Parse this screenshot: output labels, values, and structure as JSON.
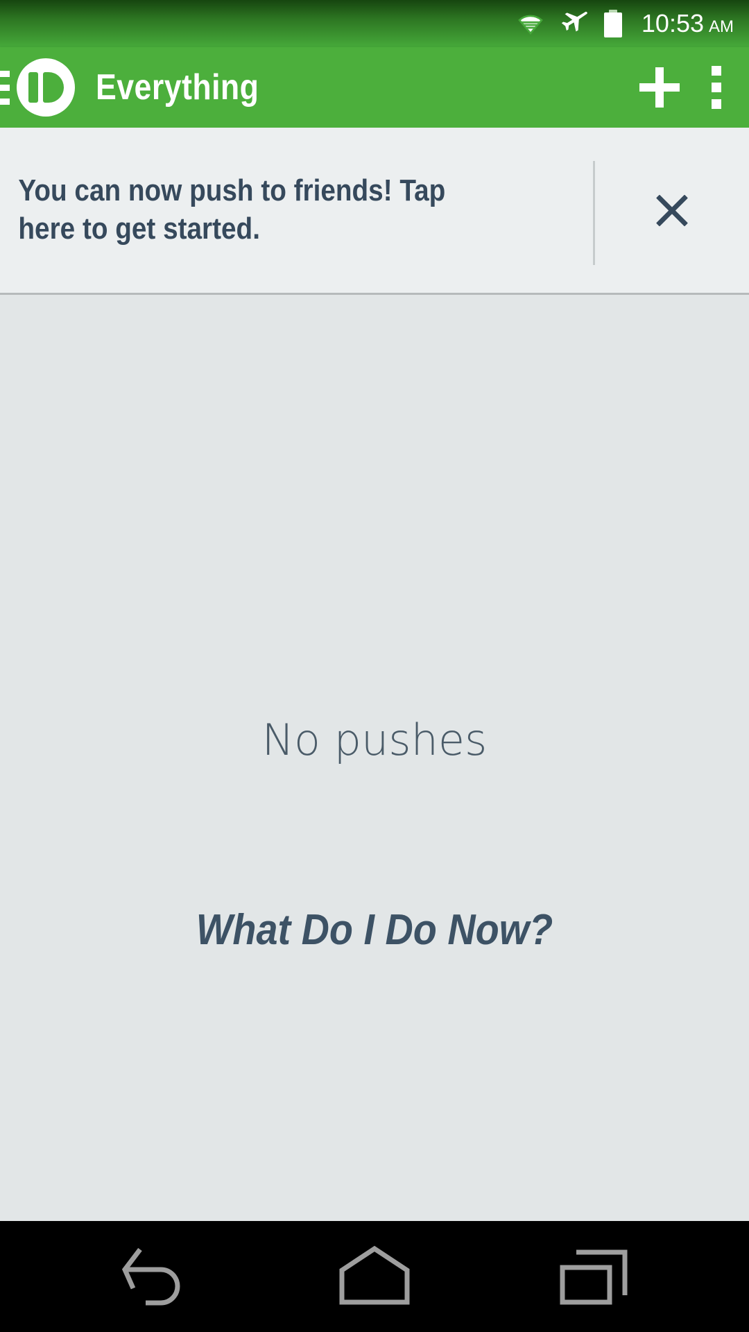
{
  "status_bar": {
    "wifi_icon": "wifi-icon",
    "airplane_icon": "airplane-mode-icon",
    "battery_icon": "battery-icon",
    "time": "10:53",
    "meridiem": "AM"
  },
  "action_bar": {
    "menu_icon": "hamburger-menu-icon",
    "logo_icon": "pushbullet-logo-icon",
    "title": "Everything",
    "add_icon": "plus-icon",
    "overflow_icon": "overflow-menu-icon",
    "background_color": "#4caf3c"
  },
  "banner": {
    "message": "You can now push to friends! Tap here to get started.",
    "close_icon": "close-icon",
    "background_color": "#eceff0",
    "text_color": "#36495c"
  },
  "content": {
    "empty_state": "No pushes",
    "promo_title": "What Do I Do Now?",
    "background_color": "#e2e6e7"
  },
  "nav_bar": {
    "back_icon": "back-icon",
    "home_icon": "home-icon",
    "recents_icon": "recents-icon",
    "background_color": "#000000"
  }
}
